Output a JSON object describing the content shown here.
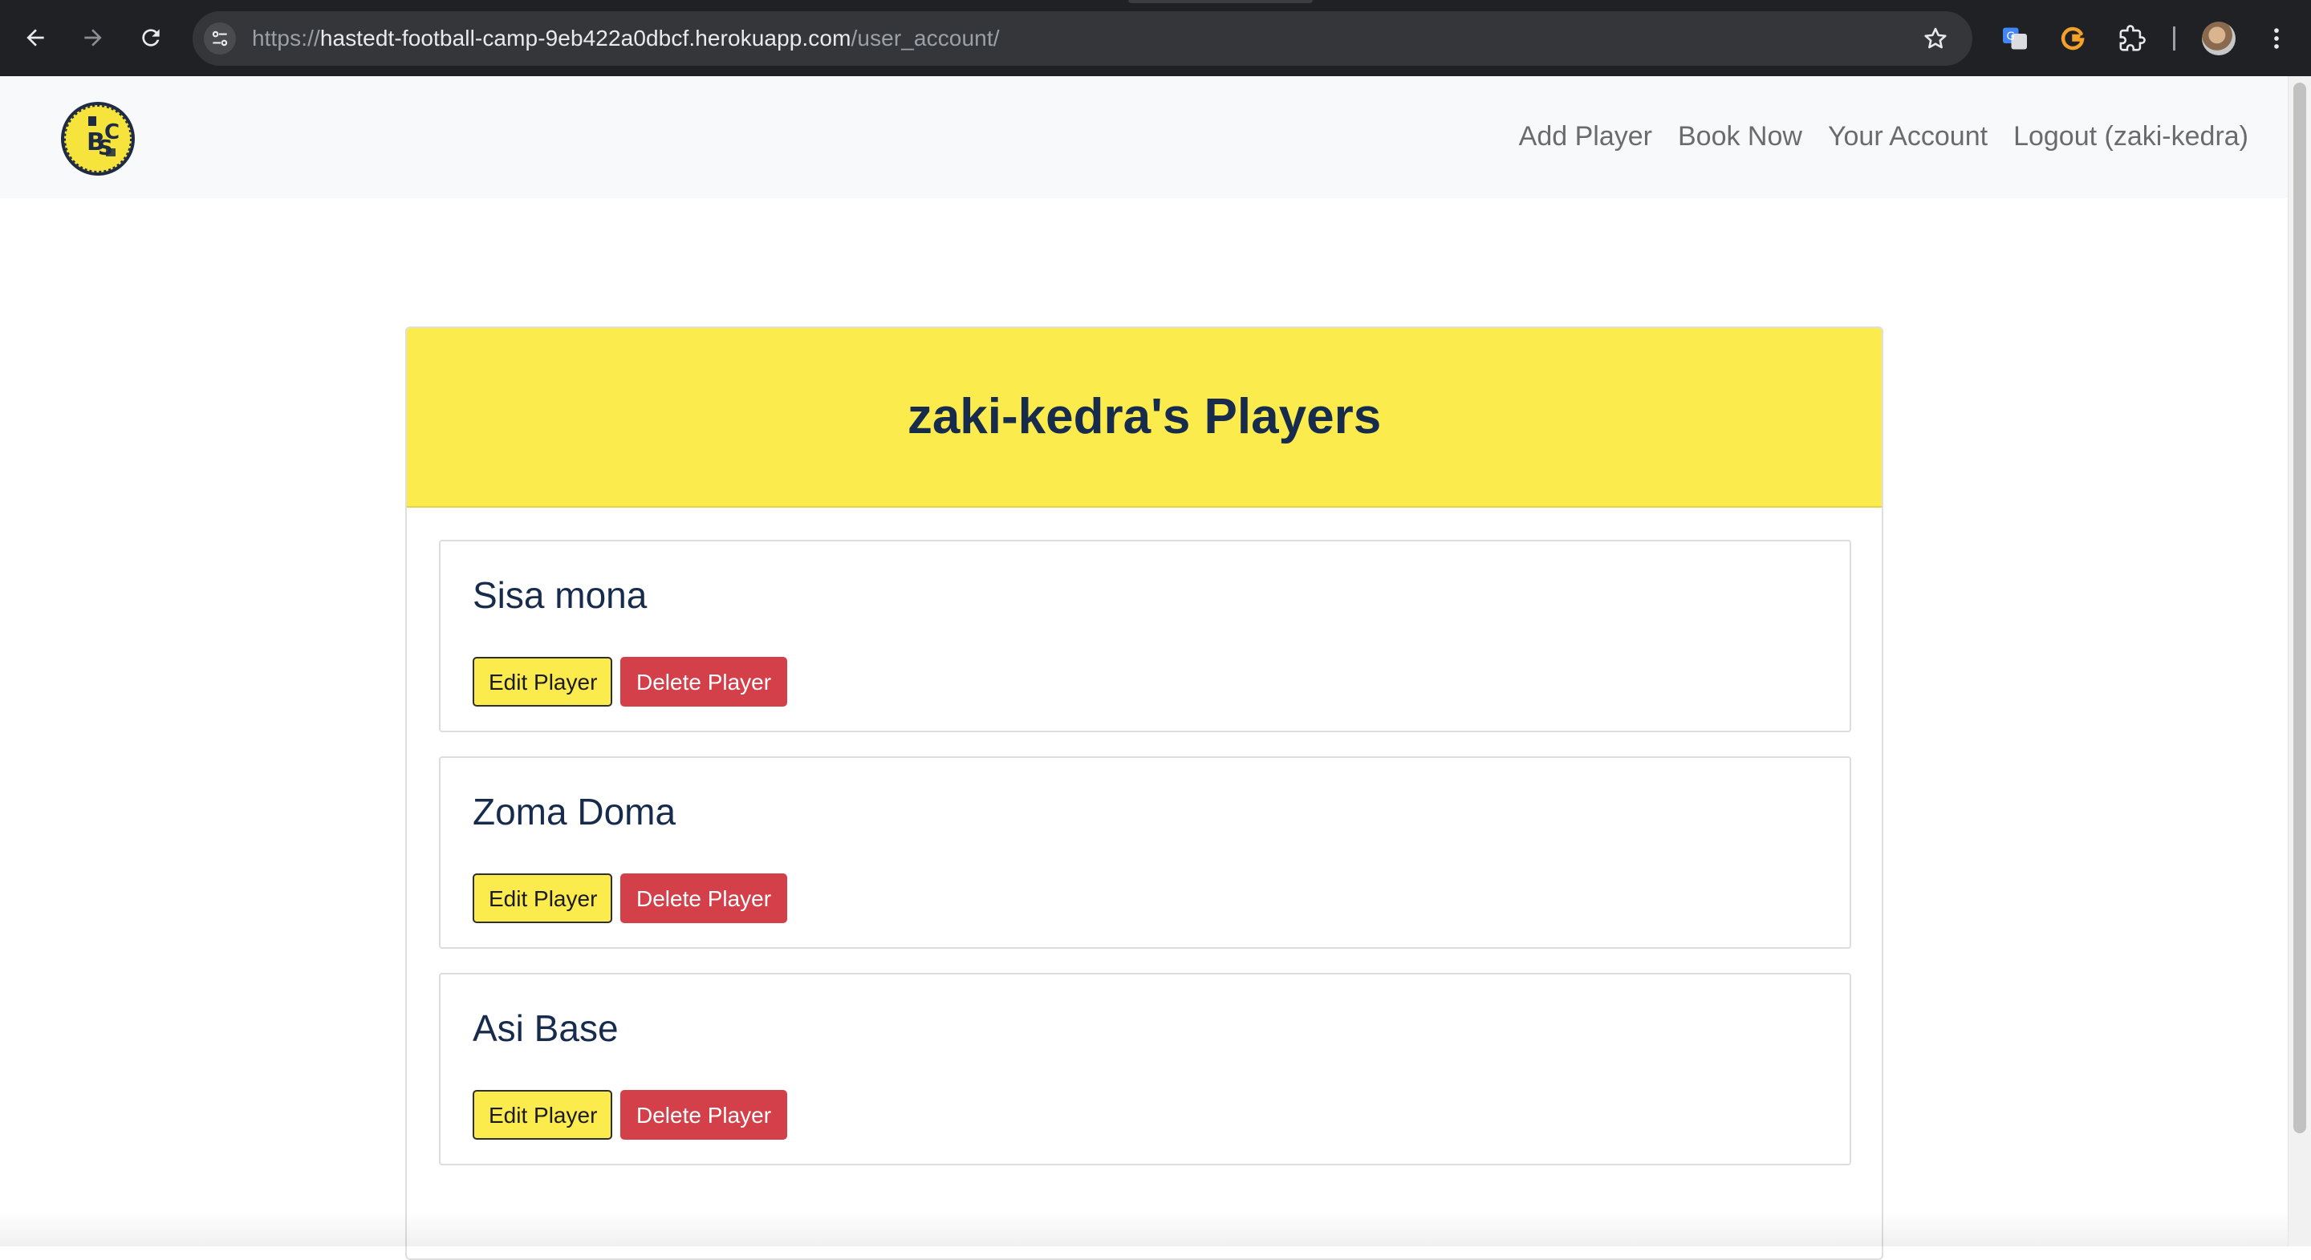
{
  "browser": {
    "url_scheme": "https://",
    "url_host": "hastedt-football-camp-9eb422a0dbcf.herokuapp.com",
    "url_path": "/user_account/"
  },
  "navbar": {
    "links": [
      {
        "label": "Add Player"
      },
      {
        "label": "Book Now"
      },
      {
        "label": "Your Account"
      },
      {
        "label": "Logout (zaki-kedra)"
      }
    ]
  },
  "main": {
    "title": "zaki-kedra's Players",
    "players": [
      {
        "name": "Sisa mona",
        "edit_label": "Edit Player",
        "delete_label": "Delete Player"
      },
      {
        "name": "Zoma Doma",
        "edit_label": "Edit Player",
        "delete_label": "Delete Player"
      },
      {
        "name": "Asi Base",
        "edit_label": "Edit Player",
        "delete_label": "Delete Player"
      }
    ]
  },
  "colors": {
    "accent_yellow": "#fbeb4d",
    "danger_red": "#d4404a",
    "title_navy": "#172b4d",
    "navbar_bg": "#f8f9fa",
    "browser_chrome": "#202124"
  },
  "icons": {
    "back": "back-arrow-icon",
    "forward": "forward-arrow-icon",
    "reload": "reload-icon",
    "site_info": "site-settings-icon",
    "bookmark": "star-icon",
    "translate": "translate-icon",
    "grammarly": "grammarly-icon",
    "extensions": "puzzle-icon",
    "menu": "kebab-menu-icon",
    "logo": "club-logo-icon"
  }
}
